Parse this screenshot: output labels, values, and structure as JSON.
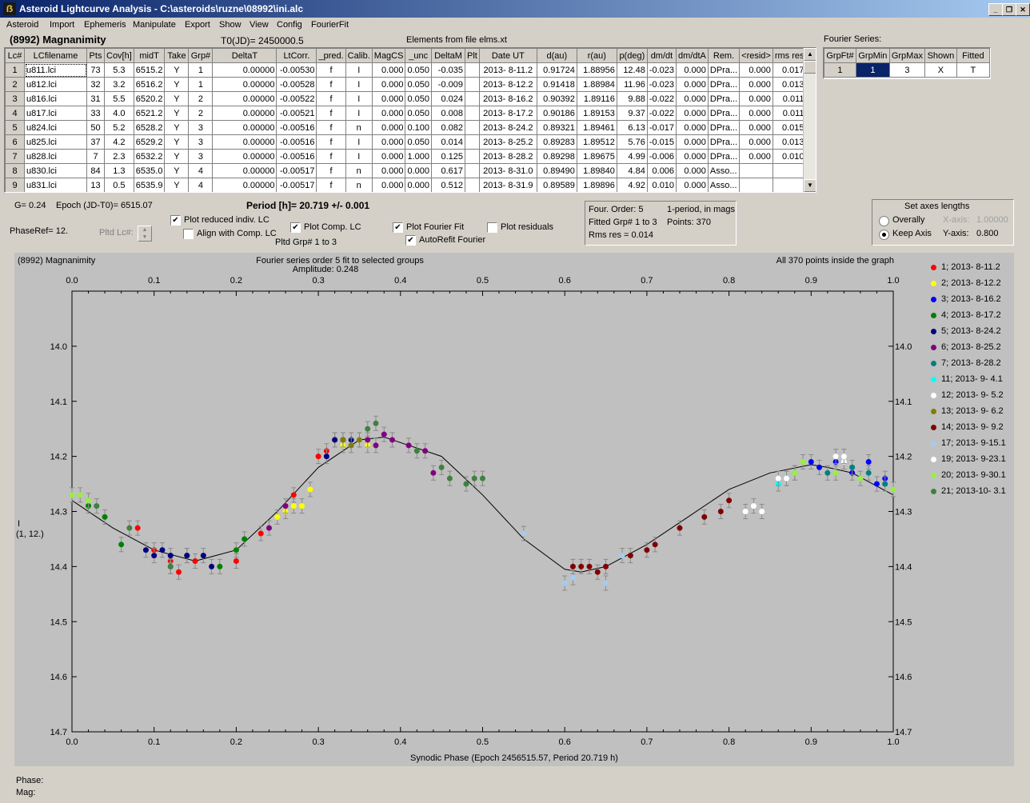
{
  "window": {
    "title": "Asteroid Lightcurve Analysis - C:\\asteroids\\ruzne\\08992\\ini.alc",
    "icon": "app-icon"
  },
  "menu": [
    "Asteroid",
    "Import",
    "Ephemeris",
    "Manipulate",
    "Export",
    "Show",
    "View",
    "Config",
    "FourierFit"
  ],
  "header": {
    "asteroid": "(8992) Magnanimity",
    "t0": "T0(JD)= 2450000.5",
    "elements": "Elements from file elms.xt",
    "fourier_series": "Fourier Series:"
  },
  "lc_table": {
    "columns": [
      "Lc#",
      "LCfilename",
      "Pts",
      "Cov[h]",
      "midT",
      "Take",
      "Grp#",
      "DeltaT",
      "LtCorr.",
      "_pred.",
      "Calib.",
      "MagCS",
      "_unc",
      "DeltaM",
      "Plt",
      "Date UT",
      "d(au)",
      "r(au)",
      "p(deg)",
      "dm/dt",
      "dm/dtA",
      "Rem.",
      "<resid>",
      "rms res"
    ],
    "rows": [
      [
        "1",
        "u811.lci",
        "73",
        "5.3",
        "6515.2",
        "Y",
        "1",
        "0.00000",
        "-0.00530",
        "f",
        "I",
        "0.000",
        "0.050",
        "-0.035",
        "",
        "2013- 8-11.2",
        "0.91724",
        "1.88956",
        "12.48",
        "-0.023",
        "0.000",
        "DPra...",
        "0.000",
        "0.017"
      ],
      [
        "2",
        "u812.lci",
        "32",
        "3.2",
        "6516.2",
        "Y",
        "1",
        "0.00000",
        "-0.00528",
        "f",
        "I",
        "0.000",
        "0.050",
        "-0.009",
        "",
        "2013- 8-12.2",
        "0.91418",
        "1.88984",
        "11.96",
        "-0.023",
        "0.000",
        "DPra...",
        "0.000",
        "0.013"
      ],
      [
        "3",
        "u816.lci",
        "31",
        "5.5",
        "6520.2",
        "Y",
        "2",
        "0.00000",
        "-0.00522",
        "f",
        "I",
        "0.000",
        "0.050",
        "0.024",
        "",
        "2013- 8-16.2",
        "0.90392",
        "1.89116",
        "9.88",
        "-0.022",
        "0.000",
        "DPra...",
        "0.000",
        "0.011"
      ],
      [
        "4",
        "u817.lci",
        "33",
        "4.0",
        "6521.2",
        "Y",
        "2",
        "0.00000",
        "-0.00521",
        "f",
        "I",
        "0.000",
        "0.050",
        "0.008",
        "",
        "2013- 8-17.2",
        "0.90186",
        "1.89153",
        "9.37",
        "-0.022",
        "0.000",
        "DPra...",
        "0.000",
        "0.011"
      ],
      [
        "5",
        "u824.lci",
        "50",
        "5.2",
        "6528.2",
        "Y",
        "3",
        "0.00000",
        "-0.00516",
        "f",
        "n",
        "0.000",
        "0.100",
        "0.082",
        "",
        "2013- 8-24.2",
        "0.89321",
        "1.89461",
        "6.13",
        "-0.017",
        "0.000",
        "DPra...",
        "0.000",
        "0.015"
      ],
      [
        "6",
        "u825.lci",
        "37",
        "4.2",
        "6529.2",
        "Y",
        "3",
        "0.00000",
        "-0.00516",
        "f",
        "I",
        "0.000",
        "0.050",
        "0.014",
        "",
        "2013- 8-25.2",
        "0.89283",
        "1.89512",
        "5.76",
        "-0.015",
        "0.000",
        "DPra...",
        "0.000",
        "0.013"
      ],
      [
        "7",
        "u828.lci",
        "7",
        "2.3",
        "6532.2",
        "Y",
        "3",
        "0.00000",
        "-0.00516",
        "f",
        "I",
        "0.000",
        "1.000",
        "0.125",
        "",
        "2013- 8-28.2",
        "0.89298",
        "1.89675",
        "4.99",
        "-0.006",
        "0.000",
        "DPra...",
        "0.000",
        "0.010"
      ],
      [
        "8",
        "u830.lci",
        "84",
        "1.3",
        "6535.0",
        "Y",
        "4",
        "0.00000",
        "-0.00517",
        "f",
        "n",
        "0.000",
        "0.000",
        "0.617",
        "",
        "2013- 8-31.0",
        "0.89490",
        "1.89840",
        "4.84",
        "0.006",
        "0.000",
        "Asso...",
        "",
        ""
      ],
      [
        "9",
        "u831.lci",
        "13",
        "0.5",
        "6535.9",
        "Y",
        "4",
        "0.00000",
        "-0.00517",
        "f",
        "n",
        "0.000",
        "0.000",
        "0.512",
        "",
        "2013- 8-31.9",
        "0.89589",
        "1.89896",
        "4.92",
        "0.010",
        "0.000",
        "Asso...",
        "",
        ""
      ]
    ]
  },
  "fourier_table": {
    "columns": [
      "GrpFt#",
      "GrpMin",
      "GrpMax",
      "Shown",
      "Fitted"
    ],
    "row": [
      "1",
      "1",
      "3",
      "X",
      "T"
    ]
  },
  "params": {
    "g": "G= 0.24",
    "epoch": "Epoch (JD-T0)= 6515.07",
    "phaseref": "PhaseRef= 12.",
    "pltd_lc": "Pltd Lc#:",
    "period": "Period [h]= 20.719 +/- 0.001",
    "plot_reduced": "Plot reduced indiv. LC",
    "align_comp": "Align with Comp. LC",
    "plot_comp": "Plot Comp. LC",
    "pltd_grp": "Pltd Grp#  1   to   3",
    "plot_fourier": "Plot Fourier Fit",
    "autorefit": "AutoRefit Fourier",
    "plot_residuals": "Plot residuals"
  },
  "fit_info": {
    "order": "Four. Order:  5",
    "mode": "1-period, in mags",
    "fitted": "Fitted Grp# 1 to 3",
    "points": "Points: 370",
    "rms": "Rms res     = 0.014"
  },
  "axes_box": {
    "title": "Set axes lengths",
    "overally": "Overally",
    "keep_axis": "Keep Axis",
    "x_axis_label": "X-axis:",
    "x_axis_value": "1.00000",
    "y_axis_label": "Y-axis:",
    "y_axis_value": "0.800"
  },
  "plot": {
    "name": "(8992) Magnanimity",
    "subtitle1": "Fourier series order 5 fit to selected groups",
    "subtitle2": "Amplitude: 0.248",
    "inside": "All 370 points inside the graph",
    "xlabel": "Synodic Phase (Epoch 2456515.57, Period 20.719 h)",
    "ylabel1": "I",
    "ylabel2": "(1, 12.)",
    "phase": "Phase:",
    "mag": "Mag:"
  },
  "chart_data": {
    "type": "scatter",
    "title": "Fourier series order 5 fit to selected groups",
    "subtitle": "Amplitude: 0.248",
    "xlabel": "Synodic Phase (Epoch 2456515.57, Period 20.719 h)",
    "ylabel": "I",
    "xlim": [
      0,
      1
    ],
    "ylim": [
      14.7,
      13.9
    ],
    "y_inverted": true,
    "xticks": [
      "0.0",
      "0.1",
      "0.2",
      "0.3",
      "0.4",
      "0.5",
      "0.6",
      "0.7",
      "0.8",
      "0.9",
      "1.0"
    ],
    "yticks": [
      "14.0",
      "14.1",
      "14.2",
      "14.3",
      "14.4",
      "14.5",
      "14.6",
      "14.7"
    ],
    "fourier_curve": {
      "x": [
        0.0,
        0.05,
        0.1,
        0.15,
        0.2,
        0.25,
        0.3,
        0.35,
        0.38,
        0.45,
        0.5,
        0.55,
        0.6,
        0.62,
        0.65,
        0.7,
        0.75,
        0.8,
        0.85,
        0.9,
        0.92,
        0.95,
        1.0
      ],
      "y": [
        14.28,
        14.33,
        14.37,
        14.39,
        14.37,
        14.3,
        14.22,
        14.17,
        14.165,
        14.2,
        14.27,
        14.35,
        14.405,
        14.41,
        14.4,
        14.36,
        14.31,
        14.26,
        14.23,
        14.215,
        14.22,
        14.23,
        14.27
      ]
    },
    "series": [
      {
        "name": "1; 2013- 8-11.2",
        "color": "#ff0000",
        "x": [
          0.08,
          0.1,
          0.12,
          0.13,
          0.15,
          0.2,
          0.23,
          0.27,
          0.3,
          0.31,
          0.32
        ],
        "y": [
          14.33,
          14.37,
          14.39,
          14.41,
          14.39,
          14.39,
          14.34,
          14.27,
          14.2,
          14.19,
          14.17
        ]
      },
      {
        "name": "2; 2013- 8-12.2",
        "color": "#ffff00",
        "x": [
          0.25,
          0.26,
          0.27,
          0.28,
          0.29,
          0.33,
          0.35,
          0.36
        ],
        "y": [
          14.31,
          14.3,
          14.29,
          14.29,
          14.26,
          14.18,
          14.17,
          14.18
        ]
      },
      {
        "name": "3; 2013- 8-16.2",
        "color": "#0000ff",
        "x": [
          0.9,
          0.91,
          0.93,
          0.95,
          0.97,
          0.98,
          0.99
        ],
        "y": [
          14.21,
          14.22,
          14.21,
          14.23,
          14.21,
          14.25,
          14.24
        ]
      },
      {
        "name": "4; 2013- 8-17.2",
        "color": "#008000",
        "x": [
          0.02,
          0.04,
          0.06,
          0.12,
          0.14,
          0.18,
          0.2,
          0.21
        ],
        "y": [
          14.29,
          14.31,
          14.36,
          14.4,
          14.38,
          14.4,
          14.37,
          14.35
        ]
      },
      {
        "name": "5; 2013- 8-24.2",
        "color": "#000080",
        "x": [
          0.09,
          0.1,
          0.11,
          0.12,
          0.14,
          0.16,
          0.17,
          0.31,
          0.32,
          0.33,
          0.34
        ],
        "y": [
          14.37,
          14.38,
          14.37,
          14.38,
          14.38,
          14.38,
          14.4,
          14.2,
          14.17,
          14.17,
          14.17
        ]
      },
      {
        "name": "6; 2013- 8-25.2",
        "color": "#800080",
        "x": [
          0.24,
          0.26,
          0.36,
          0.37,
          0.38,
          0.39,
          0.41,
          0.43,
          0.44
        ],
        "y": [
          14.33,
          14.29,
          14.17,
          14.18,
          14.16,
          14.17,
          14.18,
          14.19,
          14.23
        ]
      },
      {
        "name": "7; 2013- 8-28.2",
        "color": "#008080",
        "x": [
          0.92,
          0.95,
          0.97,
          0.99
        ],
        "y": [
          14.23,
          14.22,
          14.23,
          14.25
        ]
      },
      {
        "name": "11; 2013- 9- 4.1",
        "color": "#00ffff",
        "x": [
          0.86,
          0.87,
          0.88
        ],
        "y": [
          14.25,
          14.24,
          14.23
        ]
      },
      {
        "name": "12; 2013- 9- 5.2",
        "color": "#ffffff",
        "x": [
          0.82,
          0.84,
          0.93,
          0.94
        ],
        "y": [
          14.3,
          14.3,
          14.2,
          14.21
        ]
      },
      {
        "name": "13; 2013- 9- 6.2",
        "color": "#808000",
        "x": [
          0.33,
          0.34,
          0.35
        ],
        "y": [
          14.17,
          14.18,
          14.17
        ]
      },
      {
        "name": "14; 2013- 9- 9.2",
        "color": "#800000",
        "x": [
          0.61,
          0.62,
          0.63,
          0.64,
          0.65,
          0.68,
          0.7,
          0.71,
          0.74,
          0.77,
          0.79,
          0.8
        ],
        "y": [
          14.4,
          14.4,
          14.4,
          14.41,
          14.4,
          14.38,
          14.37,
          14.36,
          14.33,
          14.31,
          14.3,
          14.28
        ]
      },
      {
        "name": "17; 2013- 9-15.1",
        "color": "#a6caf0",
        "x": [
          0.55,
          0.6,
          0.61,
          0.65,
          0.67
        ],
        "y": [
          14.34,
          14.43,
          14.42,
          14.43,
          14.38
        ]
      },
      {
        "name": "19; 2013- 9-23.1",
        "color": "#ffffff",
        "x": [
          0.83,
          0.86,
          0.87,
          0.94
        ],
        "y": [
          14.29,
          14.24,
          14.24,
          14.2
        ]
      },
      {
        "name": "20; 2013- 9-30.1",
        "color": "#99ee44",
        "x": [
          0.0,
          0.01,
          0.02,
          0.88,
          0.89,
          0.93,
          0.96,
          1.0
        ],
        "y": [
          14.27,
          14.27,
          14.28,
          14.23,
          14.21,
          14.23,
          14.24,
          14.26
        ]
      },
      {
        "name": "21; 2013-10- 3.1",
        "color": "#408040",
        "x": [
          0.03,
          0.07,
          0.12,
          0.36,
          0.37,
          0.42,
          0.45,
          0.46,
          0.48,
          0.49,
          0.5
        ],
        "y": [
          14.29,
          14.33,
          14.4,
          14.15,
          14.14,
          14.19,
          14.22,
          14.24,
          14.25,
          14.24,
          14.24
        ]
      }
    ]
  }
}
